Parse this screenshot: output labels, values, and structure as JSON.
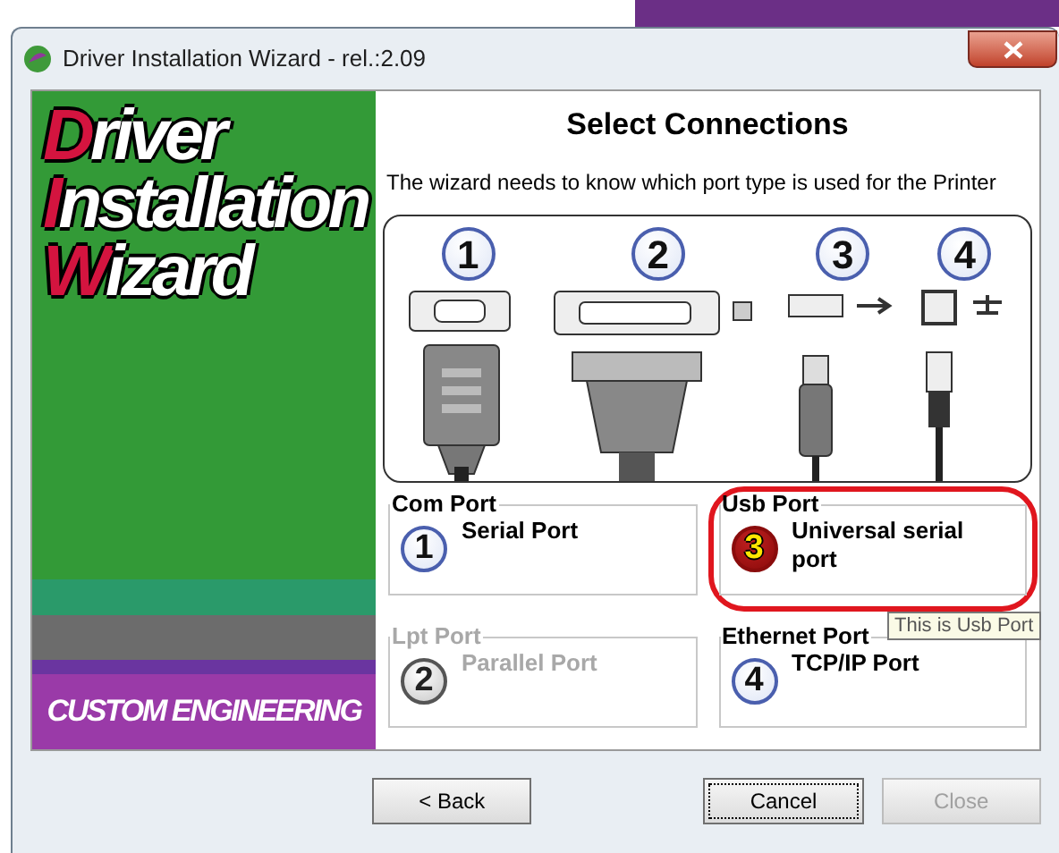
{
  "window": {
    "title": "Driver Installation Wizard - rel.:2.09"
  },
  "banner": {
    "logo_lines": [
      {
        "initial": "D",
        "rest": "river"
      },
      {
        "initial": "I",
        "rest": "nstallation"
      },
      {
        "initial": "W",
        "rest": "izard"
      }
    ],
    "company": "CUSTOM ENGINEERING"
  },
  "heading": "Select Connections",
  "description": "The wizard needs to know which port type is used for the Printer",
  "connectors": [
    {
      "number": "1",
      "kind": "serial"
    },
    {
      "number": "2",
      "kind": "parallel"
    },
    {
      "number": "3",
      "kind": "usb"
    },
    {
      "number": "4",
      "kind": "ethernet"
    }
  ],
  "ports": [
    {
      "group": "Com Port",
      "number": "1",
      "label": "Serial Port",
      "selected": false,
      "disabled": false
    },
    {
      "group": "Usb Port",
      "number": "3",
      "label": "Universal serial port",
      "selected": true,
      "disabled": false
    },
    {
      "group": "Lpt Port",
      "number": "2",
      "label": "Parallel Port",
      "selected": false,
      "disabled": true
    },
    {
      "group": "Ethernet Port",
      "number": "4",
      "label": "TCP/IP Port",
      "selected": false,
      "disabled": false
    }
  ],
  "tooltip": "This is Usb Port",
  "buttons": [
    {
      "label": "< Back",
      "disabled": false,
      "focused": false
    },
    {
      "label": "Cancel",
      "disabled": false,
      "focused": true
    },
    {
      "label": "Close",
      "disabled": true,
      "focused": false
    }
  ]
}
